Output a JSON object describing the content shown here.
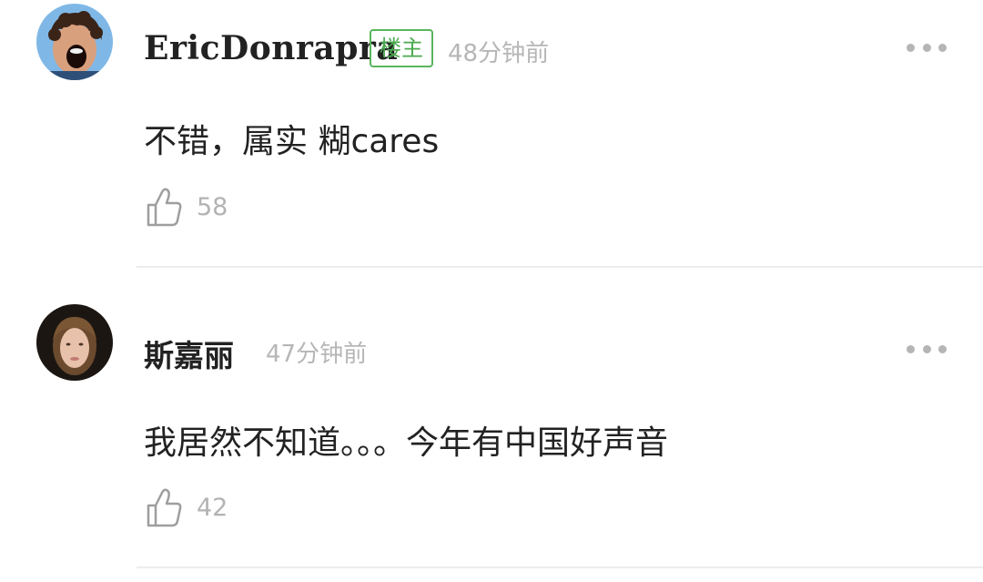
{
  "comments": [
    {
      "username": "EricDonrapra",
      "badge": "楼主",
      "time": "48分钟前",
      "content": "不错，属实 糊cares",
      "likes": "58",
      "avatar_icon": "avatar-boy-curly-hair"
    },
    {
      "username": "斯嘉丽",
      "badge": "",
      "time": "47分钟前",
      "content": "我居然不知道。。。今年有中国好声音",
      "likes": "42",
      "avatar_icon": "avatar-girl-portrait"
    }
  ],
  "colors": {
    "badge_green": "#4aa94f",
    "muted_gray": "#b6b6b6",
    "text_dark": "#222222",
    "divider": "#ededed"
  }
}
